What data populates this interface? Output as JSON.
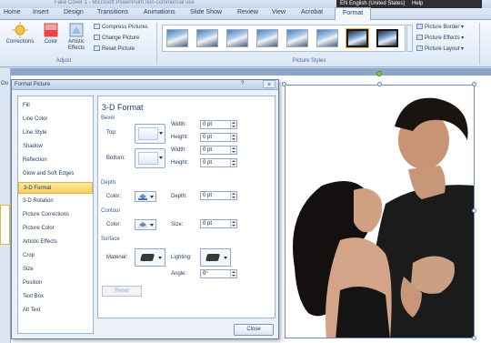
{
  "window": {
    "title": "Fake Cover 1 - Microsoft PowerPoint non-commercial use",
    "language_status": "EN English (United States)",
    "help_label": "Help"
  },
  "tabs": [
    "Home",
    "Insert",
    "Design",
    "Transitions",
    "Animations",
    "Slide Show",
    "Review",
    "View",
    "Acrobat",
    "Format"
  ],
  "active_tab": "Format",
  "ribbon": {
    "adjust": {
      "corrections": "Corrections",
      "color": "Color",
      "artistic_effects": "Artistic Effects",
      "compress": "Compress Pictures",
      "change": "Change Picture",
      "reset": "Reset Picture",
      "group_label": "Adjust"
    },
    "picture_styles": {
      "group_label": "Picture Styles",
      "border": "Picture Border",
      "effects": "Picture Effects",
      "layout": "Picture Layout",
      "thumbnail_count": 8,
      "selected_index": 6
    }
  },
  "slide_pane": {
    "label": "Ou"
  },
  "dialog": {
    "title": "Format Picture",
    "help_glyph": "?",
    "close_glyph": "×",
    "nav_items": [
      "Fill",
      "Line Color",
      "Line Style",
      "Shadow",
      "Reflection",
      "Glow and Soft Edges",
      "3-D Format",
      "3-D Rotation",
      "Picture Corrections",
      "Picture Color",
      "Artistic Effects",
      "Crop",
      "Size",
      "Position",
      "Text Box",
      "Alt Text"
    ],
    "selected_nav": "3-D Format",
    "panel": {
      "heading": "3-D Format",
      "bevel": {
        "section": "Bevel",
        "top_label": "Top:",
        "bottom_label": "Bottom:",
        "width_label": "Width:",
        "height_label": "Height:",
        "top_width": "0 pt",
        "top_height": "0 pt",
        "bottom_width": "0 pt",
        "bottom_height": "0 pt"
      },
      "depth": {
        "section": "Depth",
        "color_label": "Color:",
        "depth_label": "Depth:",
        "value": "0 pt"
      },
      "contour": {
        "section": "Contour",
        "color_label": "Color:",
        "size_label": "Size:",
        "value": "0 pt"
      },
      "surface": {
        "section": "Surface",
        "material_label": "Material:",
        "lighting_label": "Lighting:",
        "angle_label": "Angle:",
        "angle_value": "0°"
      },
      "reset_label": "Reset"
    },
    "close_label": "Close"
  },
  "colors": {
    "ribbon_bg": "#dbe7f6",
    "accent_selected": "#f8cf5b",
    "dialog_bg": "#ecf1f8",
    "workspace": "#8da5c6"
  }
}
